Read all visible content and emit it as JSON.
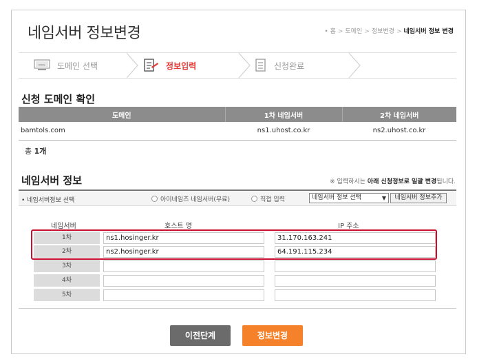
{
  "header": {
    "title": "네임서버 정보변경",
    "breadcrumb": [
      "홈",
      "도메인",
      "정보변경",
      "네임서버 정보 변경"
    ]
  },
  "steps": [
    {
      "label": "도메인 선택",
      "icon": "monitor-icon",
      "active": false
    },
    {
      "label": "정보입력",
      "icon": "edit-document-icon",
      "active": true
    },
    {
      "label": "신청완료",
      "icon": "document-icon",
      "active": false
    }
  ],
  "domain_section": {
    "title": "신청 도메인 확인",
    "columns": [
      "도메인",
      "1차 네임서버",
      "2차 네임서버"
    ],
    "rows": [
      {
        "domain": "bamtols.com",
        "ns1": "ns1.uhost.co.kr",
        "ns2": "ns2.uhost.co.kr"
      }
    ],
    "total_label": "총",
    "total_count": "1개"
  },
  "ns_section": {
    "title": "네임서버 정보",
    "notice_prefix": "※ 입력하시는",
    "notice_strong": "아래 신청정보로 일괄 변경",
    "notice_suffix": "됩니다.",
    "select_label": "네임서버정보 선택",
    "radio_options": [
      "아이네임즈 네임서버(무료)",
      "직접 입력"
    ],
    "select_value": "네임서버 정보 선택",
    "add_button": "네임서버 정보추가",
    "columns": [
      "네임서버",
      "호스트 명",
      "IP 주소"
    ],
    "rows": [
      {
        "num": "1차",
        "host": "ns1.hosinger.kr",
        "ip": "31.170.163.241"
      },
      {
        "num": "2차",
        "host": "ns2.hosinger.kr",
        "ip": "64.191.115.234"
      },
      {
        "num": "3차",
        "host": "",
        "ip": ""
      },
      {
        "num": "4차",
        "host": "",
        "ip": ""
      },
      {
        "num": "5차",
        "host": "",
        "ip": ""
      }
    ]
  },
  "buttons": {
    "prev": "이전단계",
    "submit": "정보변경"
  },
  "colors": {
    "active_step": "#e53935",
    "highlight_border": "#c8102e",
    "submit_button": "#f5822b",
    "prev_button": "#6b6b6b",
    "table_header": "#8c8c8c"
  }
}
